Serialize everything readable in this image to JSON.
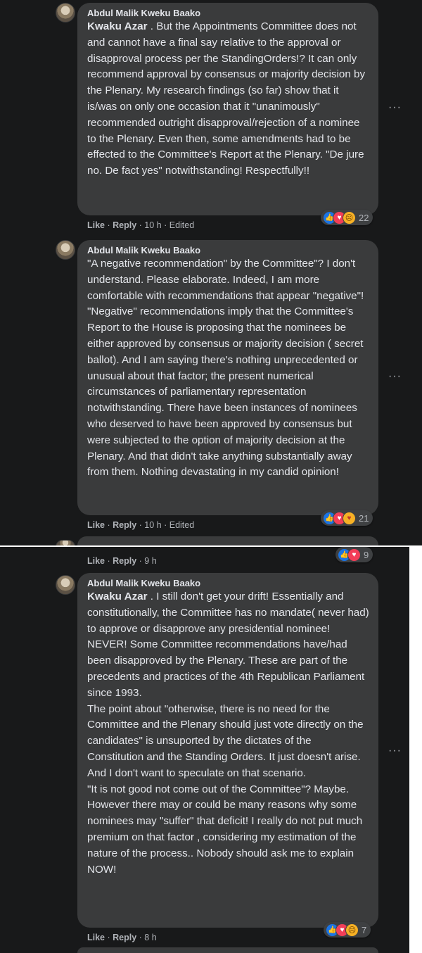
{
  "comments": [
    {
      "author": "Abdul Malik Kweku Baako",
      "mention": "Kwaku Azar",
      "text": " . But the Appointments Committee does not and cannot have a final say relative to the approval or disapproval process per the StandingOrders!? It can only recommend approval by consensus or majority decision by the Plenary. My research findings (so far) show that it is/was on only one occasion that it \"unanimously\" recommended outright disapproval/rejection of a nominee to the Plenary. Even then, some amendments had to be effected to the Committee's Report at the Plenary. \"De jure no. De fact yes\" notwithstanding! Respectfully!!",
      "like": "Like",
      "reply": "Reply",
      "time": "10 h",
      "edited": "Edited",
      "reaction_count": "22"
    },
    {
      "author": "Abdul Malik Kweku Baako",
      "mention": "",
      "text": "\"A negative recommendation\" by the Committee\"? I don't understand. Please elaborate. Indeed, I am more comfortable with recommendations that appear \"negative\"! \"Negative\" recommendations imply that the Committee's Report to the House is proposing that the nominees be either approved by consensus or majority decision ( secret ballot). And I am saying there's nothing unprecedented or unusual about that factor; the present numerical circumstances of parliamentary representation notwithstanding. There have been instances of nominees who deserved to have been approved by consensus but were subjected to the option of majority decision at the Plenary. And that didn't take anything substantially away from them. Nothing devastating in my candid opinion!",
      "like": "Like",
      "reply": "Reply",
      "time": "10 h",
      "edited": "Edited",
      "reaction_count": "21"
    },
    {
      "like": "Like",
      "reply": "Reply",
      "time": "9 h",
      "reaction_count": "9"
    },
    {
      "author": "Abdul Malik Kweku Baako",
      "mention": "Kwaku Azar",
      "text": " . I still don't get your drift! Essentially and constitutionally, the Committee has no mandate( never had) to approve or disapprove any presidential nominee! NEVER! Some Committee recommendations have/had been disapproved by the Plenary. These are part of the precedents and practices of the 4th Republican Parliament since 1993.\nThe point about \"otherwise, there is no need for the Committee and the Plenary should just vote directly on the candidates\" is unsuported by the dictates of the Constitution and the Standing Orders. It just doesn't arise. And I don't want to speculate on that scenario.\n\"It is not good not come out of the Committee\"? Maybe. However there may or could be many reasons why some nominees may \"suffer\" that deficit! I really do not put much premium on that factor , considering my estimation of the nature of the process.. Nobody should ask me to explain NOW!",
      "like": "Like",
      "reply": "Reply",
      "time": "8 h",
      "edited": "",
      "reaction_count": "7"
    }
  ],
  "more_icon": "···",
  "separator": " · ",
  "colors": {
    "background": "#18191a",
    "bubble": "#3a3b3c",
    "text": "#e4e6eb",
    "secondary": "#b0b3b8",
    "like": "#1b74e4",
    "love": "#f33e58",
    "haha_sad": "#f7b125"
  }
}
